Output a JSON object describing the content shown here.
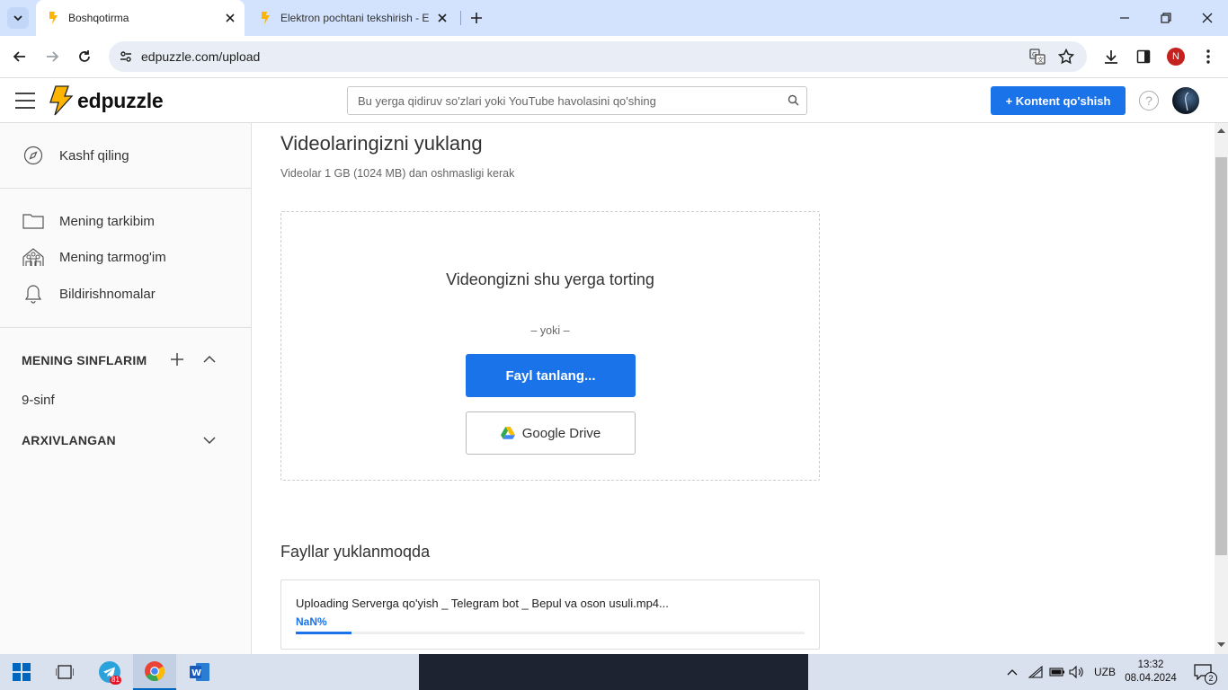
{
  "browser": {
    "tabs": [
      {
        "title": "Boshqotirma",
        "active": true
      },
      {
        "title": "Elektron pochtani tekshirish - E",
        "active": false
      }
    ],
    "url": "edpuzzle.com/upload",
    "profile_initial": "N"
  },
  "header": {
    "logo_text": "edpuzzle",
    "search_placeholder": "Bu yerga qidiruv so'zlari yoki YouTube havolasini qo'shing",
    "add_content_label": "+ Kontent qo'shish",
    "help_icon": "?"
  },
  "sidebar": {
    "explore": "Kashf qiling",
    "items": [
      {
        "label": "Mening tarkibim",
        "icon": "folder-icon"
      },
      {
        "label": "Mening tarmog'im",
        "icon": "network-icon"
      },
      {
        "label": "Bildirishnomalar",
        "icon": "bell-icon"
      }
    ],
    "classes_title": "MENING SINFLARIM",
    "classes": [
      "9-sinf"
    ],
    "archived_title": "ARXIVLANGAN"
  },
  "main": {
    "title": "Videolaringizni yuklang",
    "subtitle": "Videolar 1 GB (1024 MB) dan oshmasligi kerak",
    "drop_text": "Videongizni shu yerga torting",
    "or_text": "– yoki –",
    "choose_file_label": "Fayl tanlang...",
    "google_drive_label": "Google Drive",
    "uploading_title": "Fayllar yuklanmoqda",
    "upload": {
      "text": "Uploading Serverga qo'yish _ Telegram bot _ Bepul va oson usuli.mp4...",
      "percent_text": "NaN%",
      "progress_fraction": 0.11
    }
  },
  "taskbar": {
    "telegram_badge": "81",
    "language": "UZB",
    "time": "13:32",
    "date": "08.04.2024",
    "notification_count": "2"
  },
  "colors": {
    "accent": "#1a73e8",
    "tabstrip": "#d3e3fd",
    "logo": "#ffb400"
  }
}
